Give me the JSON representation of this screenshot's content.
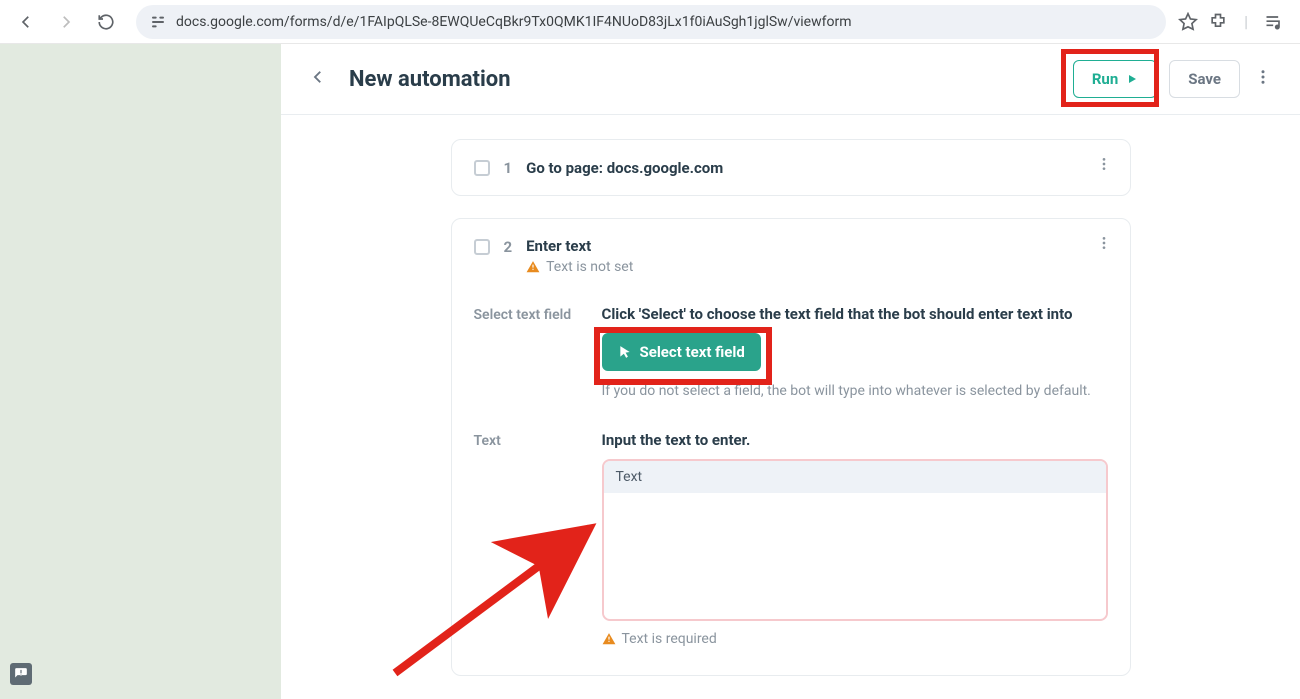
{
  "browser": {
    "url": "docs.google.com/forms/d/e/1FAIpQLSe-8EWQUeCqBkr9Tx0QMK1IF4NUoD83jLx1f0iAuSgh1jglSw/viewform"
  },
  "header": {
    "title": "New automation",
    "run_label": "Run",
    "save_label": "Save"
  },
  "steps": {
    "one": {
      "num": "1",
      "title_prefix": "Go to page: ",
      "title_url": "docs.google.com"
    },
    "two": {
      "num": "2",
      "title": "Enter text",
      "warn": "Text is not set",
      "select_label": "Select text field",
      "select_instr": "Click 'Select' to choose the text field that the bot should enter text into",
      "select_btn": "Select text field",
      "select_hint": "If you do not select a field, the bot will type into whatever is selected by default.",
      "text_label": "Text",
      "text_instr": "Input the text to enter.",
      "textarea_head": "Text",
      "textarea_value": "",
      "req_msg": "Text is required"
    }
  }
}
